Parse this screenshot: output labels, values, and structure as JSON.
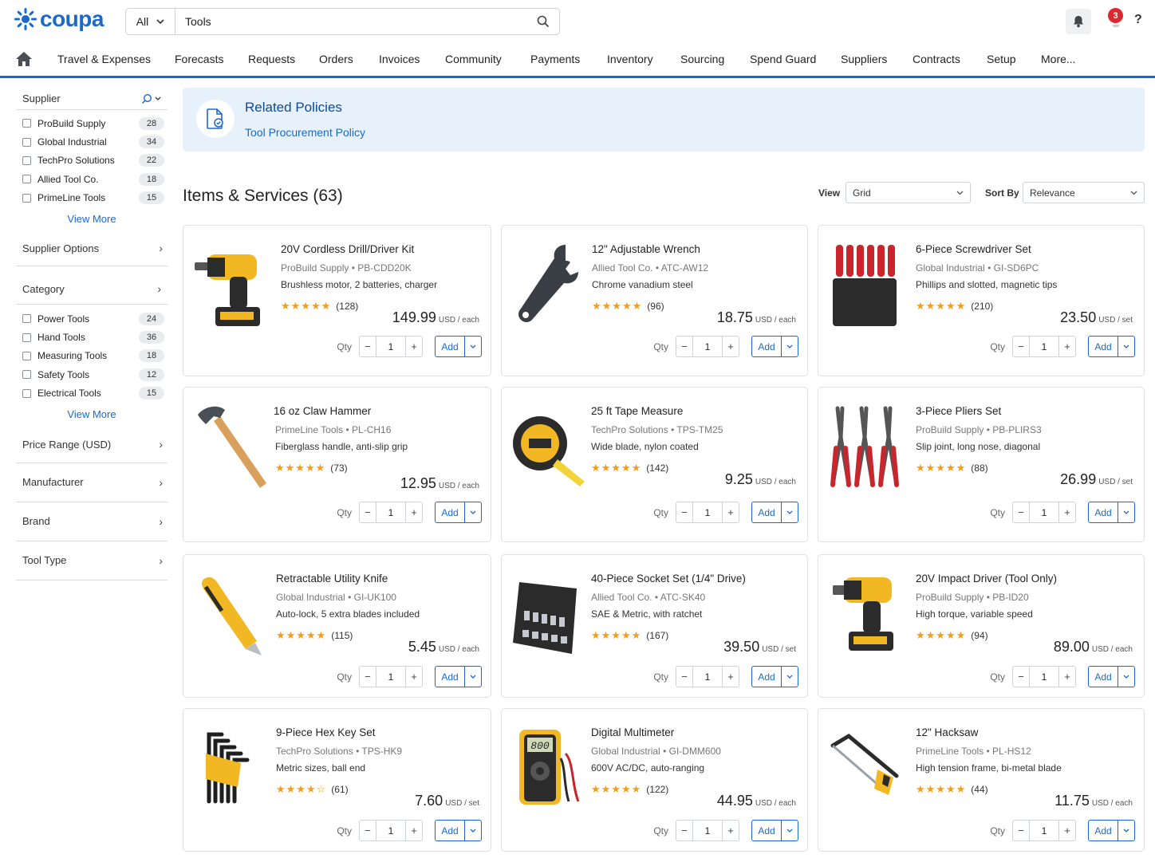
{
  "brand": {
    "logo_text": "coupa",
    "color": "#1b6ac9"
  },
  "search": {
    "scope": "All",
    "query": "Tools"
  },
  "header": {
    "notifications_count": "3",
    "help_label": "?"
  },
  "nav": {
    "items": [
      "Travel & Expenses",
      "Forecasts",
      "Requests",
      "Orders",
      "Invoices",
      "Community",
      "Payments",
      "Inventory",
      "Sourcing",
      "Spend Guard",
      "Suppliers",
      "Contracts",
      "Setup",
      "More..."
    ]
  },
  "sidebar": {
    "supplier": {
      "title": "Supplier",
      "items": [
        {
          "label": "ProBuild Supply",
          "count": "28"
        },
        {
          "label": "Global Industrial",
          "count": "34"
        },
        {
          "label": "TechPro Solutions",
          "count": "22"
        },
        {
          "label": "Allied Tool Co.",
          "count": "18"
        },
        {
          "label": "PrimeLine Tools",
          "count": "15"
        }
      ],
      "view_more": "View More"
    },
    "supplier_options": "Supplier Options",
    "category": {
      "title": "Category",
      "items": [
        {
          "label": "Power Tools",
          "count": "24"
        },
        {
          "label": "Hand Tools",
          "count": "36"
        },
        {
          "label": "Measuring Tools",
          "count": "18"
        },
        {
          "label": "Safety Tools",
          "count": "12"
        },
        {
          "label": "Electrical Tools",
          "count": "15"
        }
      ],
      "view_more": "View More"
    },
    "collapsed": [
      "Price Range (USD)",
      "Manufacturer",
      "Brand",
      "Tool Type"
    ]
  },
  "policy": {
    "title": "Related Policies",
    "link": "Tool Procurement Policy"
  },
  "items_header": {
    "title": "Items & Services (63)",
    "view_label": "View",
    "view_value": "Grid",
    "sort_label": "Sort By",
    "sort_value": "Relevance"
  },
  "labels": {
    "qty": "Qty",
    "add": "Add",
    "minus": "−",
    "plus": "+",
    "separator": "•"
  },
  "products": [
    {
      "name": "20V Cordless Drill/Driver Kit",
      "supplier": "ProBuild Supply",
      "sku": "PB-CDD20K",
      "desc": "Brushless motor, 2 batteries, charger",
      "stars": "★★★★★",
      "reviews": "(128)",
      "price": "149.99",
      "unit": "USD / each",
      "qty": "1",
      "icon": "drill-icon"
    },
    {
      "name": "12\" Adjustable Wrench",
      "supplier": "Allied Tool Co.",
      "sku": "ATC-AW12",
      "desc": "Chrome vanadium steel",
      "stars": "★★★★★",
      "reviews": "(96)",
      "price": "18.75",
      "unit": "USD / each",
      "qty": "1",
      "icon": "wrench-icon"
    },
    {
      "name": "6-Piece Screwdriver Set",
      "supplier": "Global Industrial",
      "sku": "GI-SD6PC",
      "desc": "Phillips and slotted, magnetic tips",
      "stars": "★★★★★",
      "reviews": "(210)",
      "price": "23.50",
      "unit": "USD / set",
      "qty": "1",
      "icon": "screwdriver-set-icon"
    },
    {
      "name": "16 oz Claw Hammer",
      "supplier": "PrimeLine Tools",
      "sku": "PL-CH16",
      "desc": "Fiberglass handle, anti-slip grip",
      "stars": "★★★★★",
      "reviews": "(73)",
      "price": "12.95",
      "unit": "USD / each",
      "qty": "1",
      "icon": "hammer-icon"
    },
    {
      "name": "25 ft Tape Measure",
      "supplier": "TechPro Solutions",
      "sku": "TPS-TM25",
      "desc": "Wide blade, nylon coated",
      "stars": "★★★★★",
      "reviews": "(142)",
      "price": "9.25",
      "unit": "USD / each",
      "qty": "1",
      "icon": "tape-measure-icon"
    },
    {
      "name": "3-Piece Pliers Set",
      "supplier": "ProBuild Supply",
      "sku": "PB-PLIRS3",
      "desc": "Slip joint, long nose, diagonal",
      "stars": "★★★★★",
      "reviews": "(88)",
      "price": "26.99",
      "unit": "USD / set",
      "qty": "1",
      "icon": "pliers-icon"
    },
    {
      "name": "Retractable Utility Knife",
      "supplier": "Global Industrial",
      "sku": "GI-UK100",
      "desc": "Auto-lock, 5 extra blades included",
      "stars": "★★★★★",
      "reviews": "(115)",
      "price": "5.45",
      "unit": "USD / each",
      "qty": "1",
      "icon": "utility-knife-icon"
    },
    {
      "name": "40-Piece Socket Set (1/4\" Drive)",
      "supplier": "Allied Tool Co.",
      "sku": "ATC-SK40",
      "desc": "SAE & Metric, with ratchet",
      "stars": "★★★★★",
      "reviews": "(167)",
      "price": "39.50",
      "unit": "USD / set",
      "qty": "1",
      "icon": "socket-set-icon"
    },
    {
      "name": "20V Impact Driver (Tool Only)",
      "supplier": "ProBuild Supply",
      "sku": "PB-ID20",
      "desc": "High torque, variable speed",
      "stars": "★★★★★",
      "reviews": "(94)",
      "price": "89.00",
      "unit": "USD / each",
      "qty": "1",
      "icon": "impact-driver-icon"
    },
    {
      "name": "9-Piece Hex Key Set",
      "supplier": "TechPro Solutions",
      "sku": "TPS-HK9",
      "desc": "Metric sizes, ball end",
      "stars": "★★★★☆",
      "reviews": "(61)",
      "price": "7.60",
      "unit": "USD / set",
      "qty": "1",
      "icon": "hex-key-icon"
    },
    {
      "name": "Digital Multimeter",
      "supplier": "Global Industrial",
      "sku": "GI-DMM600",
      "desc": "600V AC/DC, auto-ranging",
      "stars": "★★★★★",
      "reviews": "(122)",
      "price": "44.95",
      "unit": "USD / each",
      "qty": "1",
      "icon": "multimeter-icon",
      "display": "800"
    },
    {
      "name": "12\" Hacksaw",
      "supplier": "PrimeLine Tools",
      "sku": "PL-HS12",
      "desc": "High tension frame, bi-metal blade",
      "stars": "★★★★★",
      "reviews": "(44)",
      "price": "11.75",
      "unit": "USD / each",
      "qty": "1",
      "icon": "hacksaw-icon"
    }
  ]
}
